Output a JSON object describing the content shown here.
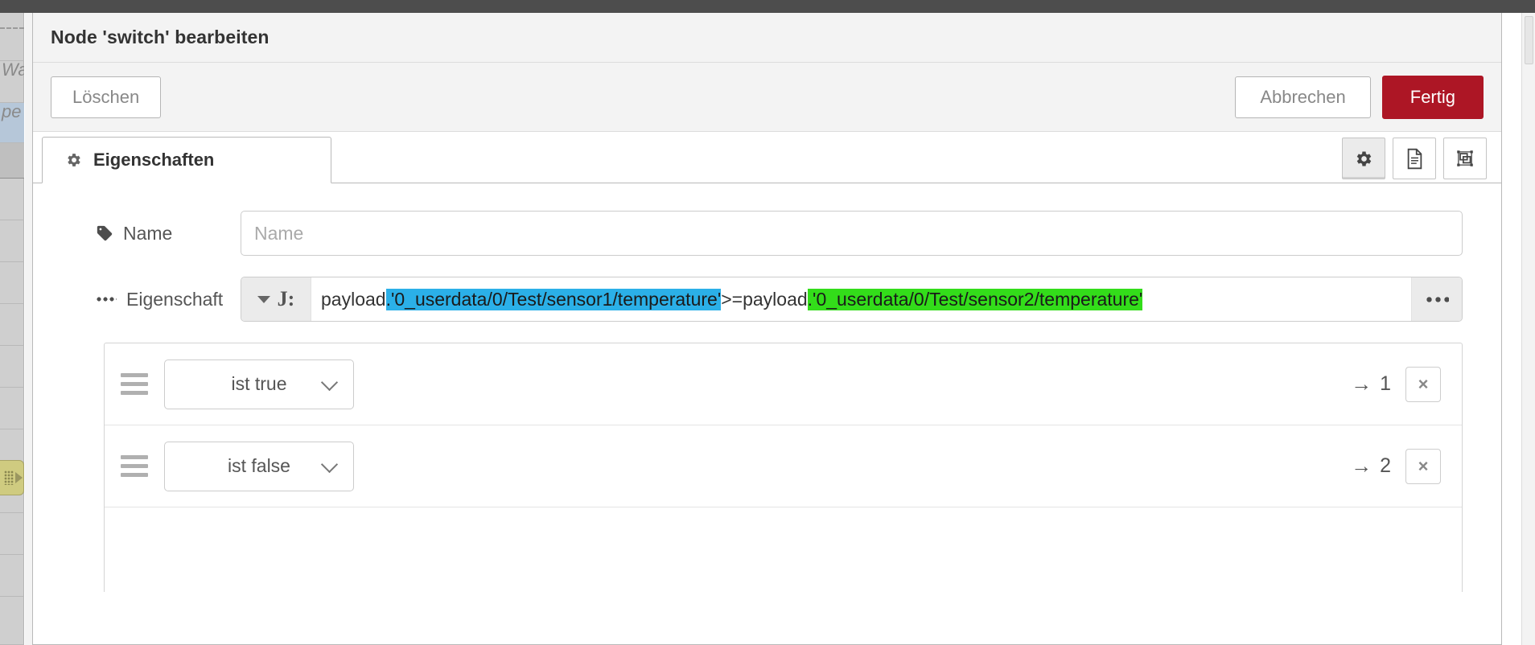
{
  "dialog": {
    "title": "Node 'switch' bearbeiten",
    "buttons": {
      "delete": "Löschen",
      "cancel": "Abbrechen",
      "done": "Fertig"
    },
    "accent_done_color": "#ad1625"
  },
  "tabs": [
    {
      "label": "Eigenschaften",
      "icon": "gear-icon",
      "active": true
    }
  ],
  "tab_icons": [
    {
      "name": "gear-icon",
      "active": true
    },
    {
      "name": "description-icon",
      "active": false
    },
    {
      "name": "appearance-icon",
      "active": false
    }
  ],
  "form": {
    "name_row": {
      "icon": "tag-icon",
      "label": "Name",
      "value": "",
      "placeholder": "Name"
    },
    "property_row": {
      "icon": "ellipsis-icon",
      "label": "Eigenschaft",
      "type_token": "J:",
      "type_name": "jsonata",
      "expression_segments": [
        {
          "text": "payload",
          "highlight": "none"
        },
        {
          "text": ".'0_userdata/0/Test/sensor1/temperature'",
          "highlight": "blue"
        },
        {
          "text": " >= ",
          "highlight": "none"
        },
        {
          "text": "payload",
          "highlight": "none"
        },
        {
          "text": ".'0_userdata/0/Test/sensor2/temperature'",
          "highlight": "green"
        }
      ],
      "expression_plain": "payload.'0_userdata/0/Test/sensor1/temperature' >= payload.'0_userdata/0/Test/sensor2/temperature'",
      "highlight_blue_color": "#2bb0e8",
      "highlight_green_color": "#33dd1a",
      "expand_button": "ellipsis-button"
    }
  },
  "rules": [
    {
      "condition": "ist true",
      "output_arrow": "→",
      "output": "1",
      "remove": "×"
    },
    {
      "condition": "ist false",
      "output_arrow": "→",
      "output": "2",
      "remove": "×"
    }
  ],
  "background": {
    "palette_texts": [
      "Wa",
      "pe"
    ]
  }
}
